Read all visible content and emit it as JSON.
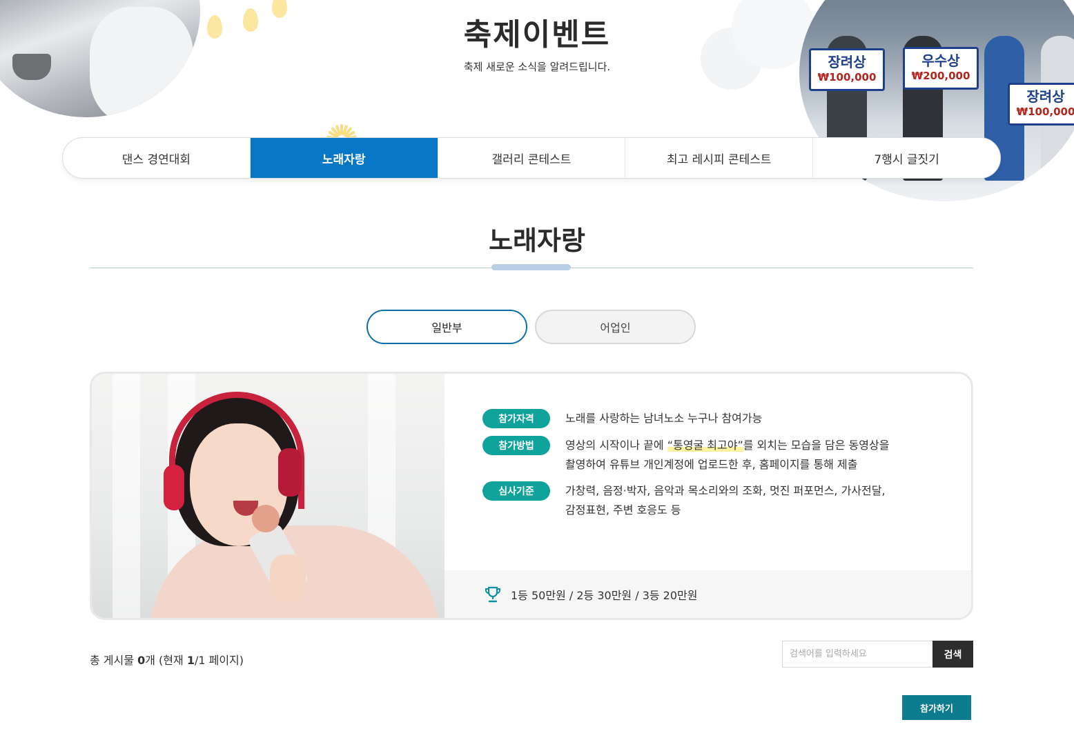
{
  "header": {
    "title": "축제이벤트",
    "subtitle": "축제 새로운 소식을 알려드립니다."
  },
  "tabs": [
    {
      "label": "댄스 경연대회",
      "active": false
    },
    {
      "label": "노래자랑",
      "active": true
    },
    {
      "label": "갤러리 콘테스트",
      "active": false
    },
    {
      "label": "최고 레시피 콘테스트",
      "active": false
    },
    {
      "label": "7행시 글짓기",
      "active": false
    }
  ],
  "section": {
    "title": "노래자랑"
  },
  "subtabs": [
    {
      "label": "일반부",
      "active": true
    },
    {
      "label": "어업인",
      "active": false
    }
  ],
  "decoration": {
    "signs": [
      {
        "title": "장려상",
        "amount": "₩100,000"
      },
      {
        "title": "우수상",
        "amount": "₩200,000"
      },
      {
        "title": "장려상",
        "amount": "₩100,000"
      }
    ]
  },
  "info": {
    "qualification": {
      "badge": "참가자격",
      "text": "노래를 사랑하는 남녀노소 누구나 참여가능"
    },
    "method": {
      "badge": "참가방법",
      "text_before": "영상의 시작이나 끝에 ",
      "highlight": "“통영굴 최고야”",
      "text_after": "를 외치는 모습을 담은 동영상을",
      "text_line2": "촬영하여 유튜브 개인계정에 업로드한 후, 홈페이지를 통해 제출"
    },
    "criteria": {
      "badge": "심사기준",
      "text_line1": "가창력, 음정·박자, 음악과 목소리와의 조화, 멋진 퍼포먼스, 가사전달,",
      "text_line2": "감정표현, 주변 호응도 등"
    },
    "prize": {
      "icon": "trophy-icon",
      "text": "1등 50만원 / 2등 30만원 / 3등 20만원"
    }
  },
  "board": {
    "total_prefix": "총 게시물 ",
    "total_count": "0",
    "total_unit": "개",
    "page_prefix": "(현재 ",
    "page_current": "1",
    "page_sep": "/1 페이지)"
  },
  "search": {
    "placeholder": "검색어를 입력하세요",
    "button_label": "검색"
  },
  "join": {
    "button_label": "참가하기"
  },
  "colors": {
    "tab_active": "#0877c5",
    "badge": "#0fa39b",
    "join_button": "#0d7c8e",
    "search_button": "#2d2d2d"
  }
}
